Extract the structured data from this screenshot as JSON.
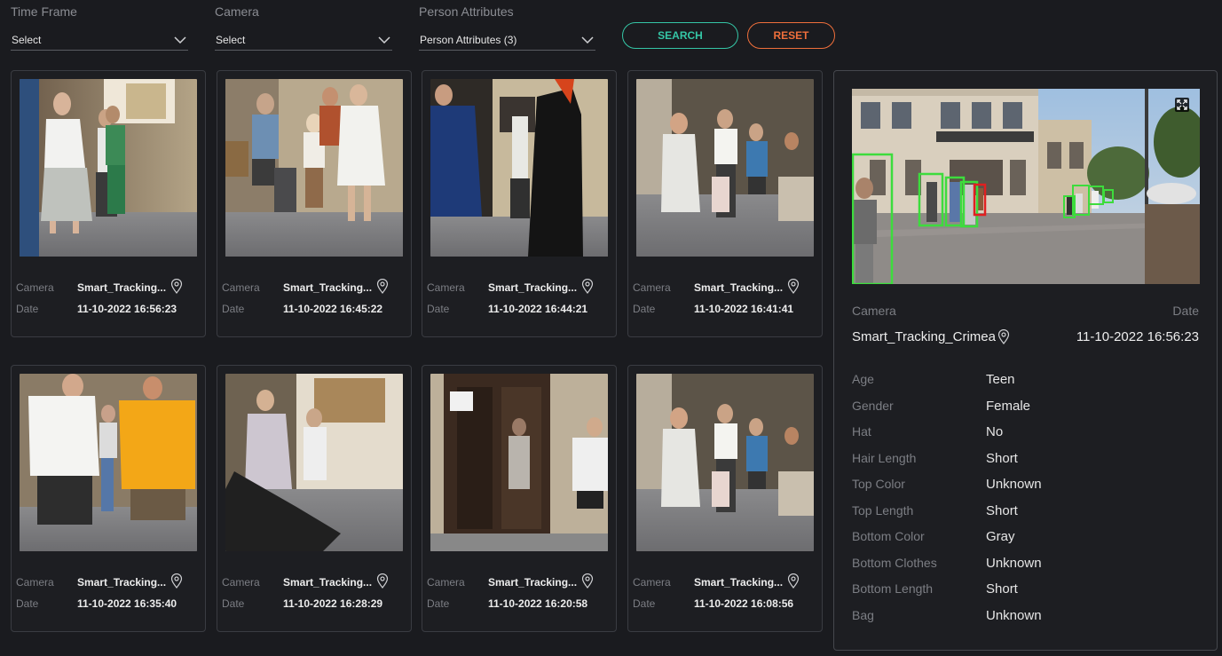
{
  "filters": {
    "time_frame": {
      "label": "Time Frame",
      "value": "Select"
    },
    "camera": {
      "label": "Camera",
      "value": "Select"
    },
    "person_attributes": {
      "label": "Person Attributes",
      "value": "Person Attributes (3)"
    }
  },
  "buttons": {
    "search": "SEARCH",
    "reset": "RESET"
  },
  "colors": {
    "search": "#35c6a6",
    "reset": "#ef6f3b",
    "box_green": "#3ddc3d",
    "box_red": "#e02020"
  },
  "results": [
    {
      "camera_label": "Camera",
      "camera": "Smart_Tracking...",
      "date_label": "Date",
      "date": "11-10-2022 16:56:23"
    },
    {
      "camera_label": "Camera",
      "camera": "Smart_Tracking...",
      "date_label": "Date",
      "date": "11-10-2022 16:45:22"
    },
    {
      "camera_label": "Camera",
      "camera": "Smart_Tracking...",
      "date_label": "Date",
      "date": "11-10-2022 16:44:21"
    },
    {
      "camera_label": "Camera",
      "camera": "Smart_Tracking...",
      "date_label": "Date",
      "date": "11-10-2022 16:41:41"
    },
    {
      "camera_label": "Camera",
      "camera": "Smart_Tracking...",
      "date_label": "Date",
      "date": "11-10-2022 16:35:40"
    },
    {
      "camera_label": "Camera",
      "camera": "Smart_Tracking...",
      "date_label": "Date",
      "date": "11-10-2022 16:28:29"
    },
    {
      "camera_label": "Camera",
      "camera": "Smart_Tracking...",
      "date_label": "Date",
      "date": "11-10-2022 16:20:58"
    },
    {
      "camera_label": "Camera",
      "camera": "Smart_Tracking...",
      "date_label": "Date",
      "date": "11-10-2022 16:08:56"
    }
  ],
  "detail": {
    "camera_label": "Camera",
    "date_label": "Date",
    "camera": "Smart_Tracking_Crimea",
    "date": "11-10-2022 16:56:23",
    "attributes": [
      {
        "key": "Age",
        "value": "Teen"
      },
      {
        "key": "Gender",
        "value": "Female"
      },
      {
        "key": "Hat",
        "value": "No"
      },
      {
        "key": "Hair Length",
        "value": "Short"
      },
      {
        "key": "Top Color",
        "value": "Unknown"
      },
      {
        "key": "Top Length",
        "value": "Short"
      },
      {
        "key": "Bottom Color",
        "value": "Gray"
      },
      {
        "key": "Bottom Clothes",
        "value": "Unknown"
      },
      {
        "key": "Bottom Length",
        "value": "Short"
      },
      {
        "key": "Bag",
        "value": "Unknown"
      }
    ]
  }
}
